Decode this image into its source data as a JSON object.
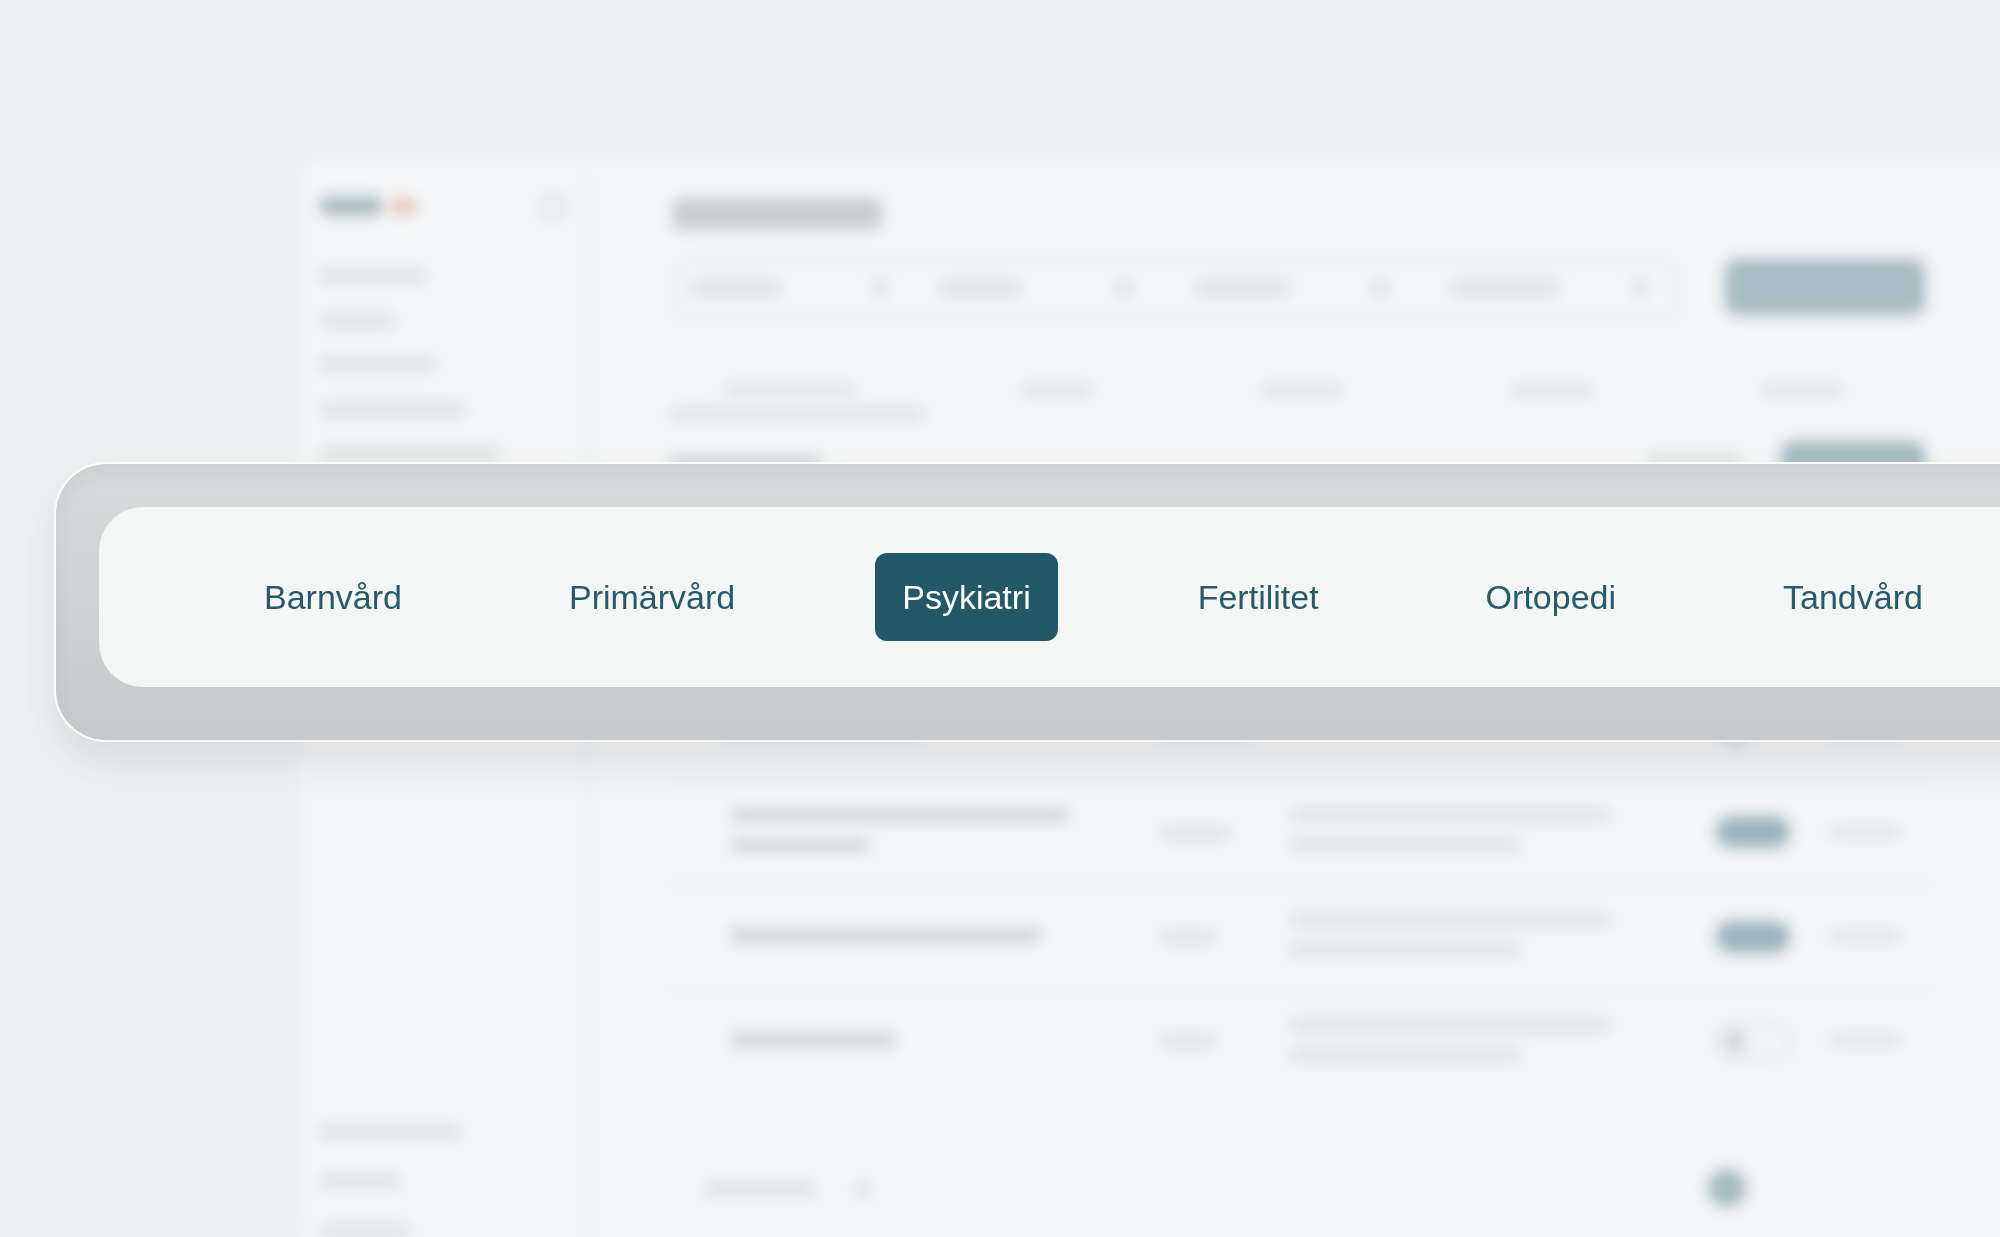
{
  "tabs": [
    {
      "label": "Barnvård",
      "selected": false
    },
    {
      "label": "Primärvård",
      "selected": false
    },
    {
      "label": "Psykiatri",
      "selected": true
    },
    {
      "label": "Fertilitet",
      "selected": false
    },
    {
      "label": "Ortopedi",
      "selected": false
    },
    {
      "label": "Tandvård",
      "selected": false
    }
  ]
}
